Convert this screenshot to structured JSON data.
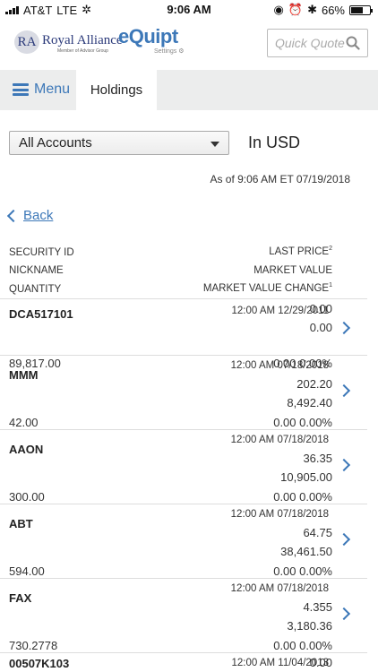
{
  "status_bar": {
    "carrier": "AT&T",
    "network": "LTE",
    "time": "9:06 AM",
    "battery": "66%",
    "battery_level": 0.66
  },
  "header": {
    "brand_initials": "RA",
    "brand_name": "Royal Alliance",
    "brand_sub": "Member of Advisor Group",
    "app_name": "eQuipt",
    "settings_label": "Settings",
    "quick_quote_placeholder": "Quick Quote"
  },
  "nav": {
    "menu_label": "Menu",
    "active_tab": "Holdings"
  },
  "filters": {
    "account_selected": "All Accounts",
    "currency": "In USD"
  },
  "as_of": "As of  9:06 AM ET 07/19/2018",
  "back_label": "Back",
  "columns": {
    "security_id": "SECURITY ID",
    "nickname": "NICKNAME",
    "quantity": "QUANTITY",
    "last_price": "LAST PRICE",
    "last_price_note": "2",
    "market_value": "MARKET VALUE",
    "mv_change": "MARKET VALUE CHANGE",
    "mv_change_note": "1"
  },
  "holdings": [
    {
      "security_id": "DCA517101",
      "date": "12:00 AM 12/29/2011",
      "last_price": "0.00",
      "market_value": "0.00",
      "quantity": "89,817.00",
      "change": "0.00 0.00%"
    },
    {
      "security_id": "MMM",
      "date": "12:00 AM 07/18/2018",
      "last_price": "202.20",
      "market_value": "8,492.40",
      "quantity": "42.00",
      "change": "0.00 0.00%"
    },
    {
      "security_id": "AAON",
      "date": "12:00 AM 07/18/2018",
      "last_price": "36.35",
      "market_value": "10,905.00",
      "quantity": "300.00",
      "change": "0.00 0.00%"
    },
    {
      "security_id": "ABT",
      "date": "12:00 AM 07/18/2018",
      "last_price": "64.75",
      "market_value": "38,461.50",
      "quantity": "594.00",
      "change": "0.00 0.00%"
    },
    {
      "security_id": "FAX",
      "date": "12:00 AM 07/18/2018",
      "last_price": "4.355",
      "market_value": "3,180.36",
      "quantity": "730.2778",
      "change": "0.00 0.00%"
    },
    {
      "security_id": "00507K103",
      "date": "12:00 AM 11/04/2013",
      "last_price": "0.00",
      "market_value": "",
      "quantity": "",
      "change": ""
    }
  ]
}
